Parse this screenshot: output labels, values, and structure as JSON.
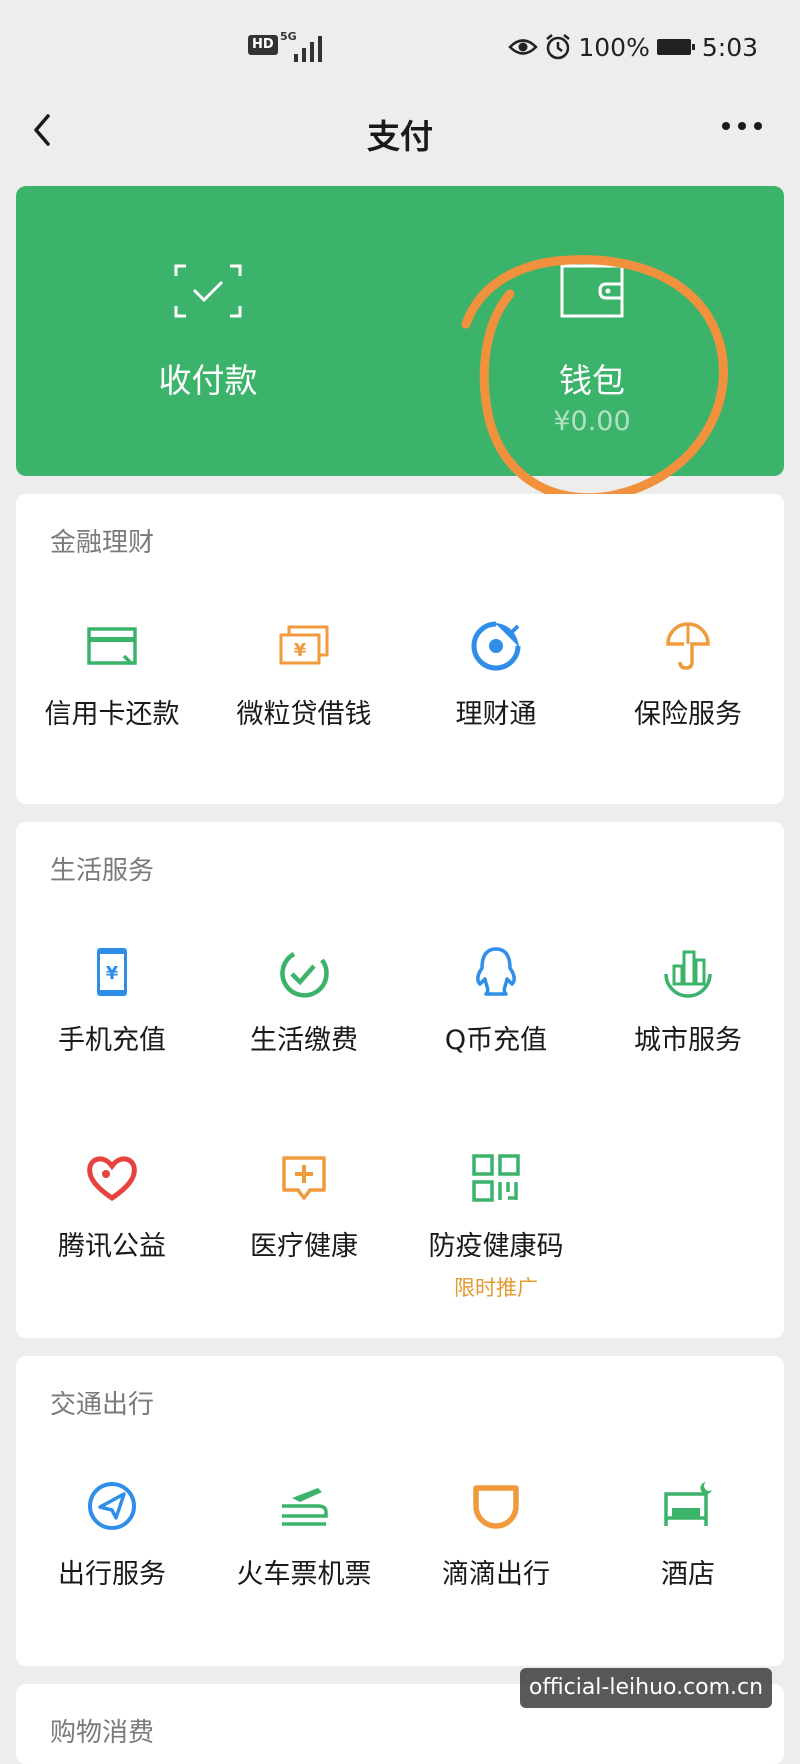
{
  "status": {
    "hd": "HD",
    "net": "5G",
    "battery_pct": "100%",
    "time": "5:03"
  },
  "nav": {
    "title": "支付"
  },
  "pay_card": {
    "receive_label": "收付款",
    "wallet_label": "钱包",
    "wallet_balance": "¥0.00"
  },
  "sections": {
    "finance": {
      "title": "金融理财",
      "items": [
        {
          "label": "信用卡还款",
          "icon": "credit-card-icon"
        },
        {
          "label": "微粒贷借钱",
          "icon": "loan-icon"
        },
        {
          "label": "理财通",
          "icon": "wealth-icon"
        },
        {
          "label": "保险服务",
          "icon": "insurance-icon"
        }
      ]
    },
    "life": {
      "title": "生活服务",
      "items": [
        {
          "label": "手机充值",
          "icon": "phone-topup-icon"
        },
        {
          "label": "生活缴费",
          "icon": "utility-bill-icon"
        },
        {
          "label": "Q币充值",
          "icon": "qq-coin-icon"
        },
        {
          "label": "城市服务",
          "icon": "city-service-icon"
        },
        {
          "label": "腾讯公益",
          "icon": "charity-icon"
        },
        {
          "label": "医疗健康",
          "icon": "medical-icon"
        },
        {
          "label": "防疫健康码",
          "icon": "qr-code-icon",
          "sub": "限时推广"
        }
      ]
    },
    "transport": {
      "title": "交通出行",
      "items": [
        {
          "label": "出行服务",
          "icon": "travel-icon"
        },
        {
          "label": "火车票机票",
          "icon": "train-plane-icon"
        },
        {
          "label": "滴滴出行",
          "icon": "didi-icon"
        },
        {
          "label": "酒店",
          "icon": "hotel-icon"
        }
      ]
    },
    "shopping": {
      "title": "购物消费"
    }
  },
  "watermark": "official-leihuo.com.cn",
  "colors": {
    "green": "#3cb36a",
    "orange": "#f09a3e",
    "blue": "#2e8ee8",
    "red": "#e64340",
    "annotation": "#f2913d"
  }
}
